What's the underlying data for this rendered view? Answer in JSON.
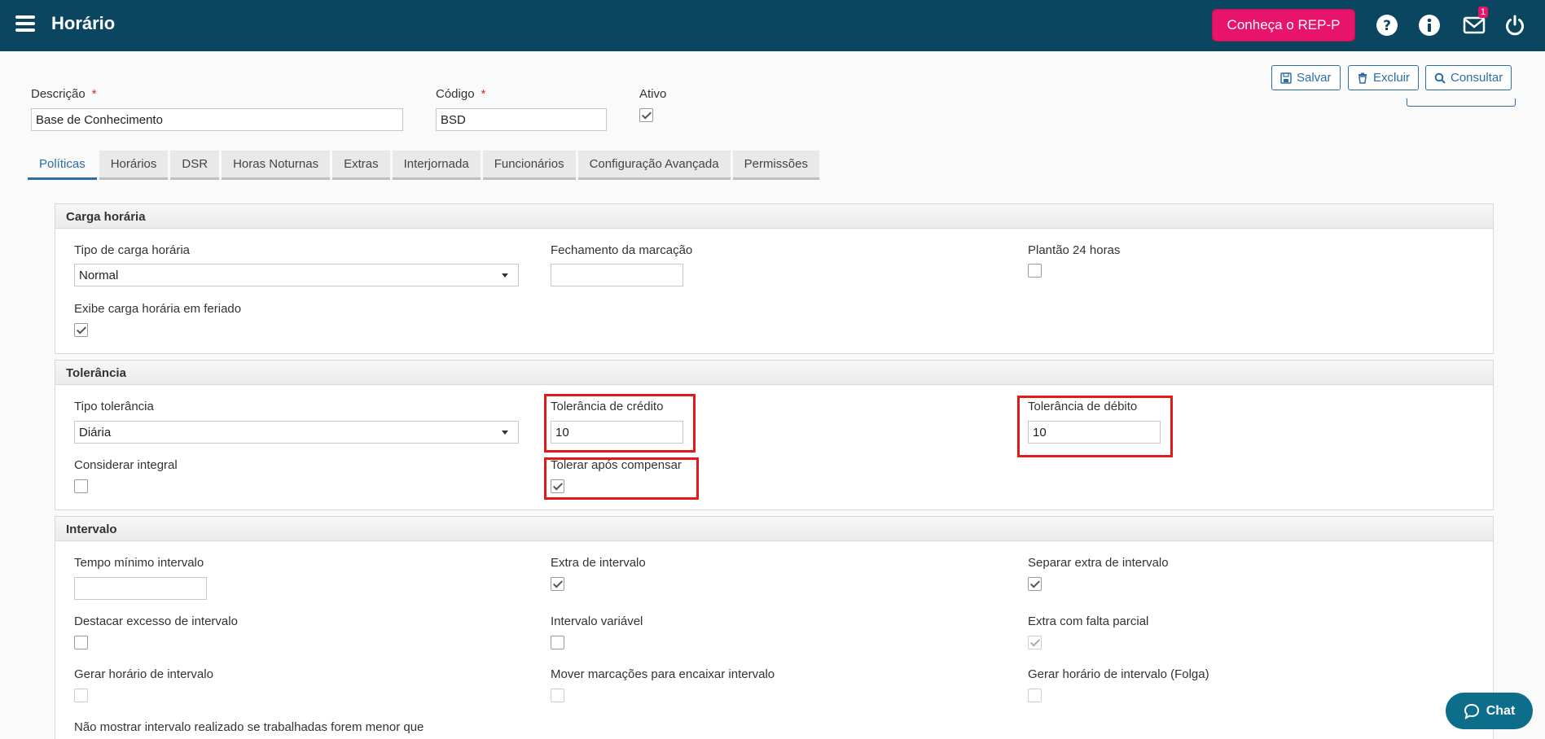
{
  "header": {
    "title": "Horário",
    "rep_button": "Conheça o REP-P",
    "mail_badge": "1"
  },
  "toolbar": {
    "save": "Salvar",
    "delete": "Excluir",
    "query": "Consultar"
  },
  "form": {
    "descricao_label": "Descrição",
    "descricao_value": "Base de Conhecimento",
    "codigo_label": "Código",
    "codigo_value": "BSD",
    "ativo_label": "Ativo",
    "required_mark": "*"
  },
  "tabs": [
    "Políticas",
    "Horários",
    "DSR",
    "Horas Noturnas",
    "Extras",
    "Interjornada",
    "Funcionários",
    "Configuração Avançada",
    "Permissões"
  ],
  "carga": {
    "title": "Carga horária",
    "tipo_label": "Tipo de carga horária",
    "tipo_value": "Normal",
    "fechamento_label": "Fechamento da marcação",
    "fechamento_value": "",
    "plantao_label": "Plantão 24 horas",
    "exibe_label": "Exibe carga horária em feriado"
  },
  "tolerancia": {
    "title": "Tolerância",
    "tipo_label": "Tipo tolerância",
    "tipo_value": "Diária",
    "credito_label": "Tolerância de crédito",
    "credito_value": "10",
    "debito_label": "Tolerância de débito",
    "debito_value": "10",
    "integral_label": "Considerar integral",
    "compensar_label": "Tolerar após compensar"
  },
  "intervalo": {
    "title": "Intervalo",
    "tempo_label": "Tempo mínimo intervalo",
    "tempo_value": "",
    "extra_label": "Extra de intervalo",
    "separar_label": "Separar extra de intervalo",
    "destacar_label": "Destacar excesso de intervalo",
    "variavel_label": "Intervalo variável",
    "falta_label": "Extra com falta parcial",
    "gerar_label": "Gerar horário de intervalo",
    "mover_label": "Mover marcações para encaixar intervalo",
    "gerar_folga_label": "Gerar horário de intervalo (Folga)",
    "nao_mostrar_label": "Não mostrar intervalo realizado se trabalhadas forem menor que"
  },
  "chat": {
    "label": "Chat"
  }
}
